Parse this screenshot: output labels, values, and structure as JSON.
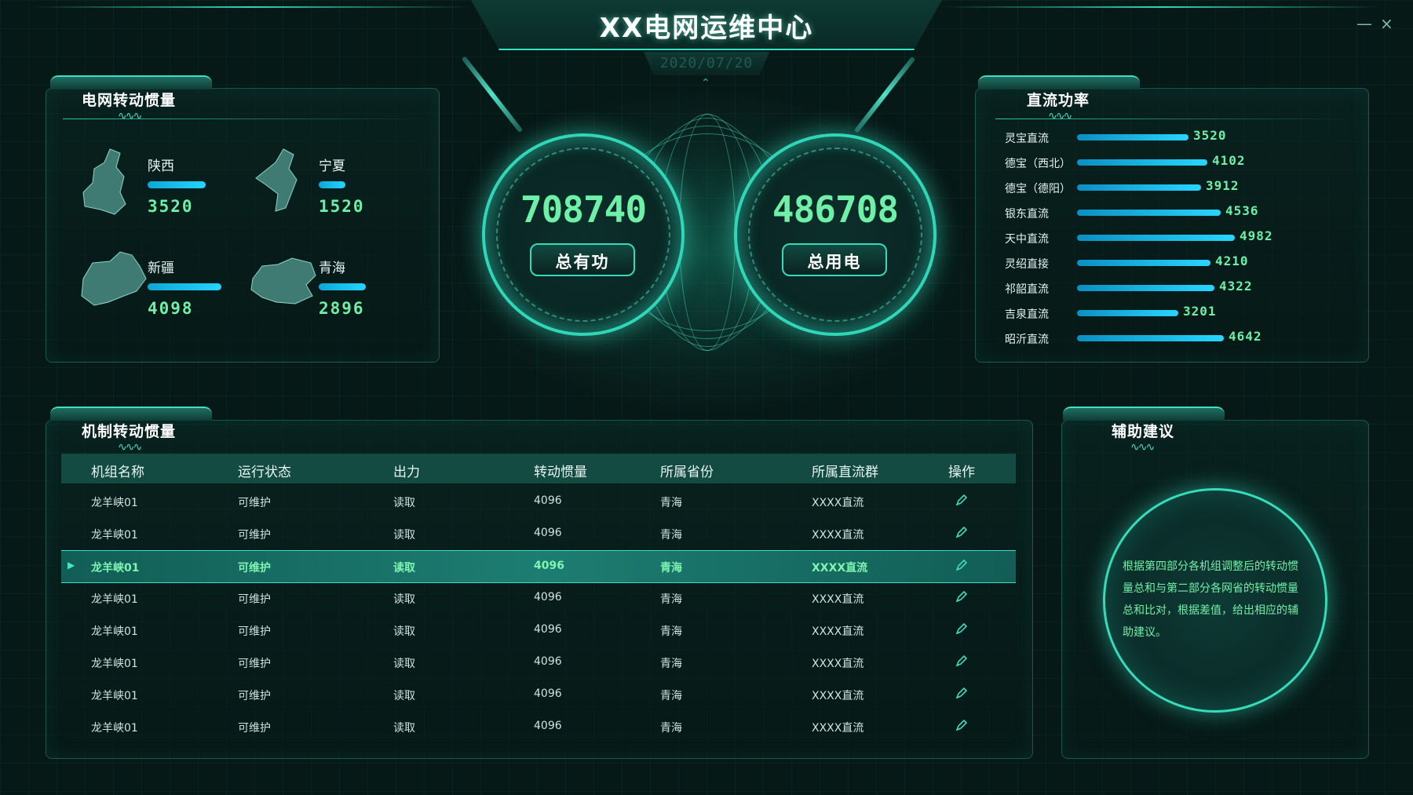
{
  "header": {
    "title": "XX电网运维中心",
    "date": "2020/07/20",
    "minimize_label": "—",
    "close_label": "×"
  },
  "grid_inertia": {
    "title": "电网转动惯量",
    "provinces": [
      {
        "name": "陕西",
        "value": "3520"
      },
      {
        "name": "宁夏",
        "value": "1520"
      },
      {
        "name": "新疆",
        "value": "4098"
      },
      {
        "name": "青海",
        "value": "2896"
      }
    ]
  },
  "center": {
    "active_power": {
      "value": "708740",
      "label": "总有功"
    },
    "power_use": {
      "value": "486708",
      "label": "总用电"
    }
  },
  "dc_power": {
    "title": "直流功率",
    "rows": [
      {
        "name": "灵宝直流",
        "value": "3520"
      },
      {
        "name": "德宝（西北）",
        "value": "4102"
      },
      {
        "name": "德宝（德阳）",
        "value": "3912"
      },
      {
        "name": "银东直流",
        "value": "4536"
      },
      {
        "name": "天中直流",
        "value": "4982"
      },
      {
        "name": "灵绍直接",
        "value": "4210"
      },
      {
        "name": "祁韶直流",
        "value": "4322"
      },
      {
        "name": "吉泉直流",
        "value": "3201"
      },
      {
        "name": "昭沂直流",
        "value": "4642"
      }
    ]
  },
  "unit_table": {
    "title": "机制转动惯量",
    "columns": [
      "机组名称",
      "运行状态",
      "出力",
      "转动惯量",
      "所属省份",
      "所属直流群",
      "操作"
    ],
    "rows": [
      [
        "龙羊峡01",
        "可维护",
        "读取",
        "4096",
        "青海",
        "XXXX直流"
      ],
      [
        "龙羊峡01",
        "可维护",
        "读取",
        "4096",
        "青海",
        "XXXX直流"
      ],
      [
        "龙羊峡01",
        "可维护",
        "读取",
        "4096",
        "青海",
        "XXXX直流"
      ],
      [
        "龙羊峡01",
        "可维护",
        "读取",
        "4096",
        "青海",
        "XXXX直流"
      ],
      [
        "龙羊峡01",
        "可维护",
        "读取",
        "4096",
        "青海",
        "XXXX直流"
      ],
      [
        "龙羊峡01",
        "可维护",
        "读取",
        "4096",
        "青海",
        "XXXX直流"
      ],
      [
        "龙羊峡01",
        "可维护",
        "读取",
        "4096",
        "青海",
        "XXXX直流"
      ],
      [
        "龙羊峡01",
        "可维护",
        "读取",
        "4096",
        "青海",
        "XXXX直流"
      ]
    ],
    "selected_row": 2,
    "action_icon": "edit-icon"
  },
  "advice": {
    "title": "辅助建议",
    "text": "根据第四部分各机组调整后的转动惯量总和与第二部分各网省的转动惯量总和比对，根据差值，给出相应的辅助建议。"
  },
  "colors": {
    "accent": "#2fd8b7",
    "value_green": "#6ff0a8",
    "bar_blue": "#23d5ff",
    "background": "#071917"
  }
}
